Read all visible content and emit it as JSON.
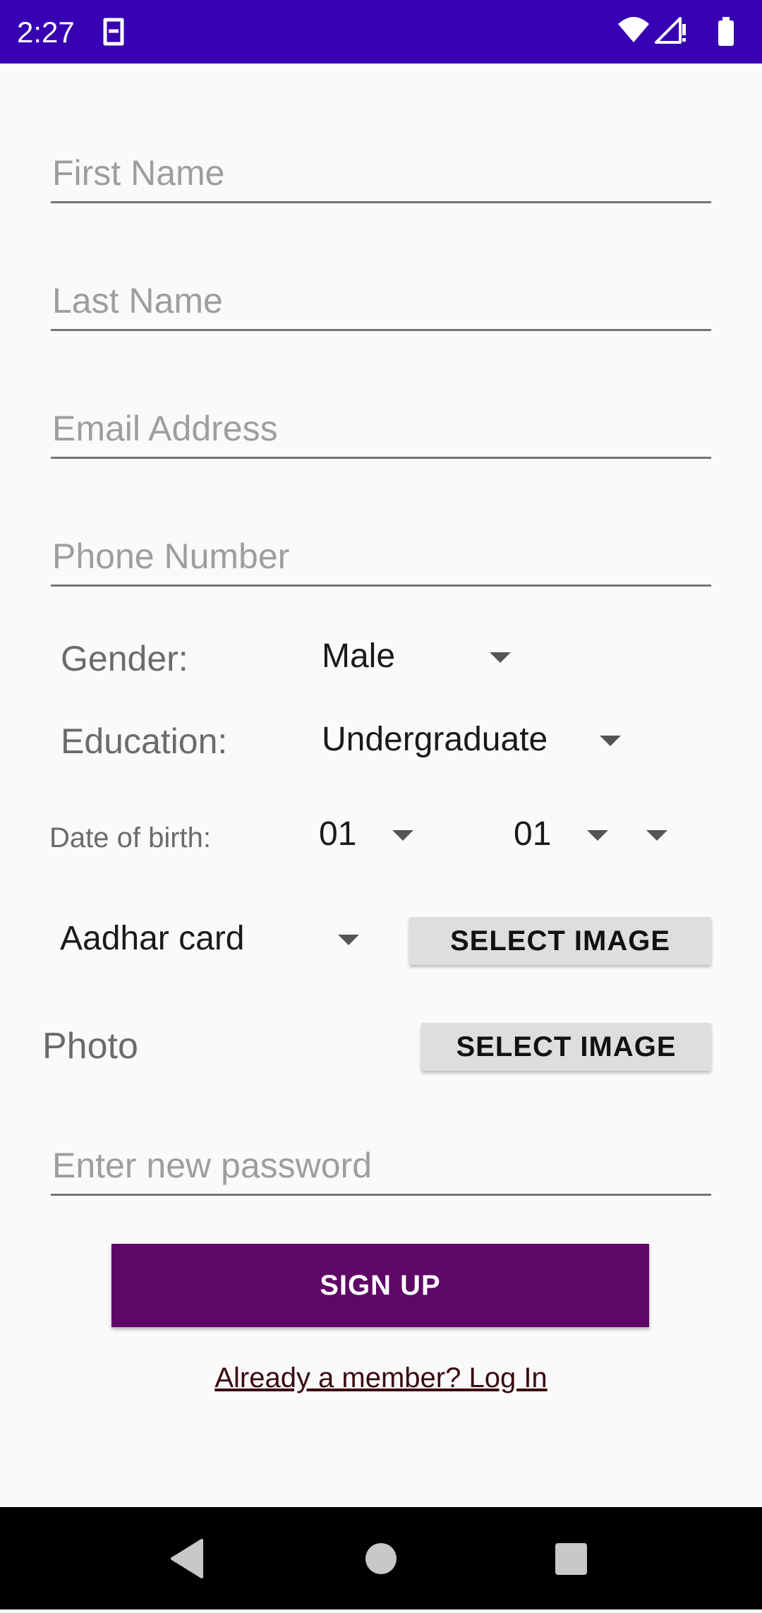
{
  "status_bar": {
    "time": "2:27"
  },
  "form": {
    "first_name_placeholder": "First Name",
    "last_name_placeholder": "Last Name",
    "email_placeholder": "Email Address",
    "phone_placeholder": "Phone Number",
    "gender_label": "Gender:",
    "gender_value": "Male",
    "education_label": "Education:",
    "education_value": "Undergraduate",
    "dob_label": "Date of birth:",
    "dob_day": "01",
    "dob_month": "01",
    "dob_year": "",
    "id_doc_value": "Aadhar card",
    "id_doc_button": "SELECT IMAGE",
    "photo_label": "Photo",
    "photo_button": "SELECT IMAGE",
    "password_placeholder": "Enter new password",
    "signup_button": "SIGN UP",
    "login_link": "Already a member? Log In"
  },
  "colors": {
    "status_bar": "#3700b3",
    "signup_button": "#5f0766",
    "background": "#fafafa",
    "nav_bar": "#000000"
  },
  "icons": {
    "status": [
      "notification-icon",
      "wifi-icon",
      "signal-icon",
      "battery-icon"
    ],
    "nav": [
      "back-icon",
      "home-icon",
      "recents-icon"
    ]
  }
}
